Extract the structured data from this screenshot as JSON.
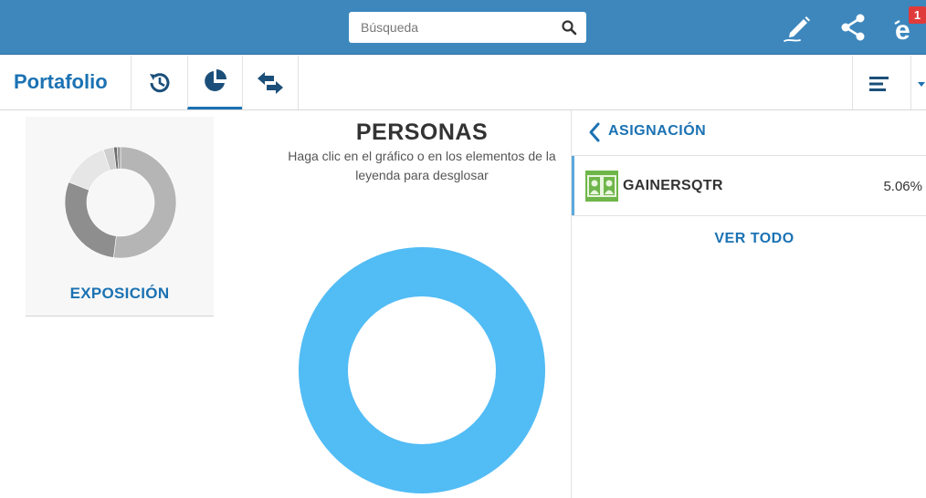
{
  "topbar": {
    "search_placeholder": "Búsqueda",
    "notification_count": "1",
    "icons": [
      "search-icon",
      "pencil-icon",
      "share-icon",
      "etoro-e-icon"
    ]
  },
  "subbar": {
    "title": "Portafolio",
    "tabs": [
      {
        "name": "history",
        "icon": "history-icon"
      },
      {
        "name": "pie",
        "icon": "pie-chart-icon",
        "active": true
      },
      {
        "name": "transfers",
        "icon": "arrows-icon"
      }
    ]
  },
  "left_card": {
    "label": "EXPOSICIÓN",
    "chart_data": {
      "type": "pie",
      "values": [
        52,
        29,
        14,
        3,
        1,
        1
      ],
      "colors": [
        "#b5b5b5",
        "#8e8e8e",
        "#e6e6e6",
        "#cfcfcf",
        "#6e6e6e",
        "#9c9c9c"
      ]
    }
  },
  "center": {
    "title": "PERSONAS",
    "subtitle": "Haga clic en el gráfico o en los elementos de la leyenda para desglosar",
    "chart_data": {
      "type": "pie",
      "values": [
        100
      ],
      "colors": [
        "#52bcf5"
      ]
    }
  },
  "right": {
    "back_label": "ASIGNACIÓN",
    "items": [
      {
        "name": "GAINERSQTR",
        "value": "5.06%"
      }
    ],
    "view_all": "VER TODO"
  },
  "colors": {
    "brand_blue": "#3d87bd",
    "link_blue": "#1b72b3",
    "donut_blue": "#52bcf5"
  }
}
